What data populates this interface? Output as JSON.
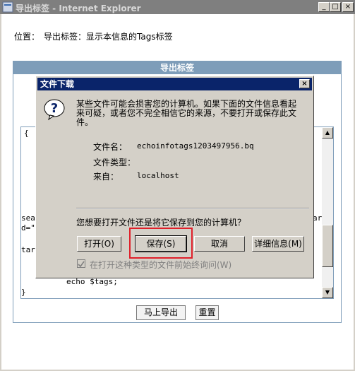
{
  "window": {
    "title": "导出标签 - Internet Explorer",
    "min_label": "_",
    "max_label": "□",
    "close_label": "×"
  },
  "location": {
    "label": "位置：",
    "text": "导出标签：显示本信息的Tags标签"
  },
  "panel": {
    "header": "导出标签"
  },
  "code": {
    "lines": [
      "{",
      "sear",
      "d=\"",
      "targ",
      "echo $tags;",
      "}",
      "ar"
    ]
  },
  "form_buttons": {
    "export": "马上导出",
    "reset": "重置"
  },
  "dialog": {
    "title": "文件下载",
    "close": "×",
    "warning": "某些文件可能会损害您的计算机。如果下面的文件信息看起来可疑，或者您不完全相信它的来源，不要打开或保存此文件。",
    "file_name_label": "文件名：",
    "file_name": "echoinfotags1203497956.bq",
    "file_type_label": "文件类型：",
    "file_type": "",
    "from_label": "来自：",
    "from": "localhost",
    "question": "您想要打开文件还是将它保存到您的计算机？",
    "buttons": {
      "open": "打开(O)",
      "save": "保存(S)",
      "cancel": "取消",
      "more_info": "详细信息(M)"
    },
    "always_ask": "在打开这种类型的文件前始终询问(W)",
    "always_ask_checked": true
  }
}
